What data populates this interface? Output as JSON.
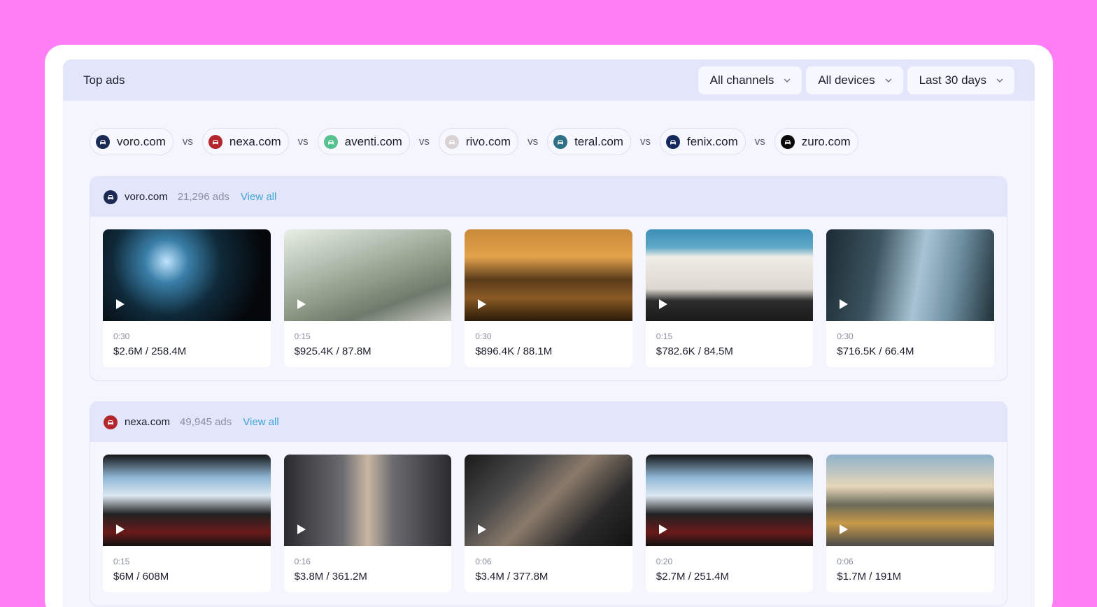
{
  "header": {
    "title": "Top ads",
    "filters": [
      {
        "label": "All channels"
      },
      {
        "label": "All devices"
      },
      {
        "label": "Last 30 days"
      }
    ]
  },
  "compare": {
    "vs_label": "vs",
    "brands": [
      {
        "name": "voro.com",
        "color": "#1b2a55"
      },
      {
        "name": "nexa.com",
        "color": "#b3262c"
      },
      {
        "name": "aventi.com",
        "color": "#57c28f"
      },
      {
        "name": "rivo.com",
        "color": "#d9d2d4"
      },
      {
        "name": "teral.com",
        "color": "#2f6f88"
      },
      {
        "name": "fenix.com",
        "color": "#15295c"
      },
      {
        "name": "zuro.com",
        "color": "#0a0a0a"
      }
    ]
  },
  "sections": [
    {
      "brand": "voro.com",
      "color": "#1b2a55",
      "count": "21,296 ads",
      "link": "View all",
      "ads": [
        {
          "duration": "0:30",
          "stats": "$2.6M / 258.4M",
          "thumb": "radial-gradient(circle at 38% 35%, #bfe4ff 0%, #3a7fa8 18%, #0f2a3a 45%, #05080b 80%)"
        },
        {
          "duration": "0:15",
          "stats": "$925.4K / 87.8M",
          "thumb": "linear-gradient(160deg, #e8efe6 0%, #b8c2b5 30%, #8f9c87 55%, #6f7a6c 75%, #c9c9c4 100%)"
        },
        {
          "duration": "0:30",
          "stats": "$896.4K / 88.1M",
          "thumb": "linear-gradient(180deg, #c98a3a 0%, #e3a24a 30%, #5a3a1a 55%, #8a5a24 75%, #2a1a0a 100%)"
        },
        {
          "duration": "0:15",
          "stats": "$782.6K / 84.5M",
          "thumb": "linear-gradient(180deg, #3a8fb5 0%, #62a9c9 20%, #efece6 30%, #dcd8d0 65%, #2c2c2c 78%, #1a1a1a 100%)"
        },
        {
          "duration": "0:30",
          "stats": "$716.5K / 66.4M",
          "thumb": "linear-gradient(100deg, #1c2a33 0%, #3c5560 30%, #a8c4d4 55%, #6d8fa0 75%, #203038 100%)"
        }
      ]
    },
    {
      "brand": "nexa.com",
      "color": "#b3262c",
      "count": "49,945 ads",
      "link": "View all",
      "ads": [
        {
          "duration": "0:15",
          "stats": "$6M / 608M",
          "thumb": "linear-gradient(180deg, #151515 0%, #8fb6d6 25%, #dbe8f2 45%, #222 65%, #6a1a1a 85%, #111 100%)"
        },
        {
          "duration": "0:16",
          "stats": "$3.8M / 361.2M",
          "thumb": "linear-gradient(90deg, #2b2b2e 0%, #6b6b70 35%, #c9b7a3 50%, #6b6b70 65%, #2b2b2e 100%)"
        },
        {
          "duration": "0:06",
          "stats": "$3.4M / 377.8M",
          "thumb": "linear-gradient(135deg, #1a1a1a 0%, #4a4a4a 30%, #8a7a6a 50%, #2a2a2a 75%, #111 100%)"
        },
        {
          "duration": "0:20",
          "stats": "$2.7M / 251.4M",
          "thumb": "linear-gradient(180deg, #151515 0%, #8fb6d6 25%, #dbe8f2 45%, #222 65%, #6a1a1a 85%, #111 100%)"
        },
        {
          "duration": "0:06",
          "stats": "$1.7M / 191M",
          "thumb": "linear-gradient(180deg, #8fb2cc 0%, #e6d6b8 35%, #6a6a58 55%, #c79a4a 75%, #4a4a4a 100%)"
        }
      ]
    }
  ]
}
